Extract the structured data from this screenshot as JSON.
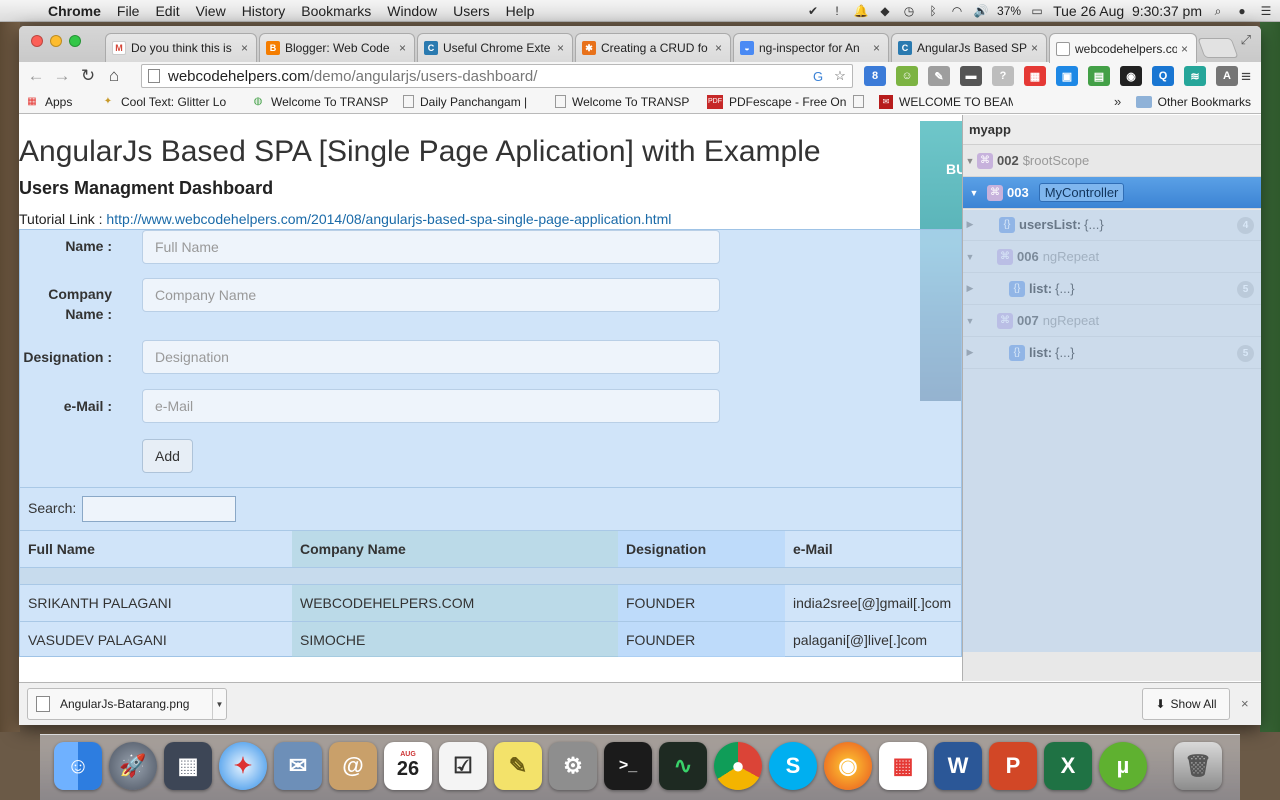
{
  "menubar": {
    "app": "Chrome",
    "items": [
      "File",
      "Edit",
      "View",
      "History",
      "Bookmarks",
      "Window",
      "Users",
      "Help"
    ],
    "battery": "37%",
    "datetime": "Tue 26 Aug  9:30:37 pm"
  },
  "tabs": [
    {
      "title": "Do you think this is",
      "favicon": "gmail-icon",
      "color": "#d44638"
    },
    {
      "title": "Blogger: Web Code",
      "favicon": "blogger-icon",
      "color": "#f57d00"
    },
    {
      "title": "Useful Chrome Exte",
      "favicon": "webcodehelpers-icon",
      "color": "#2a7ab0"
    },
    {
      "title": "Creating a CRUD fo",
      "favicon": "orange-icon",
      "color": "#e8711a"
    },
    {
      "title": "ng-inspector for An",
      "favicon": "chrome-store-icon",
      "color": "#4a8af4"
    },
    {
      "title": "AngularJs Based SP",
      "favicon": "webcodehelpers-icon",
      "color": "#2a7ab0"
    },
    {
      "title": "webcodehelpers.co",
      "favicon": "page-icon",
      "color": "#ffffff"
    }
  ],
  "address": {
    "host": "webcodehelpers.com",
    "path": "/demo/angularjs/users-dashboard/"
  },
  "bookmarks": [
    {
      "label": "Apps",
      "icon": "apps-grid-icon"
    },
    {
      "label": "Cool Text: Glitter Lo",
      "icon": "cooltext-icon"
    },
    {
      "label": "Welcome To TRANSP",
      "icon": "globe-icon"
    },
    {
      "label": "Daily Panchangam | ",
      "icon": "page-icon"
    },
    {
      "label": "Welcome To TRANSP",
      "icon": "page-icon"
    },
    {
      "label": "PDFescape - Free On",
      "icon": "pdf-icon"
    },
    {
      "label": "",
      "icon": "page-icon"
    },
    {
      "label": "WELCOME TO BEAM",
      "icon": "beam-icon"
    }
  ],
  "bookmarks_other": "Other Bookmarks",
  "page": {
    "title": "AngularJs Based SPA [Single Page Aplication] with Example",
    "subtitle": "Users Managment Dashboard",
    "tutorial_prefix": "Tutorial Link :",
    "tutorial_url": "http://www.webcodehelpers.com/2014/08/angularjs-based-spa-single-page-application.html",
    "banner_text": "BU"
  },
  "form": {
    "name_label": "Name :",
    "name_placeholder": "Full Name",
    "company_label_1": "Company",
    "company_label_2": "Name :",
    "company_placeholder": "Company Name",
    "designation_label": "Designation :",
    "designation_placeholder": "Designation",
    "email_label": "e-Mail :",
    "email_placeholder": "e-Mail",
    "add_label": "Add",
    "search_label": "Search:"
  },
  "table": {
    "headers": [
      "Full Name",
      "Company Name",
      "Designation",
      "e-Mail"
    ],
    "rows": [
      [
        "SRIKANTH PALAGANI",
        "WEBCODEHELPERS.COM",
        "FOUNDER",
        "india2sree[@]gmail[.]com"
      ],
      [
        "VASUDEV PALAGANI",
        "SIMOCHE",
        "FOUNDER",
        "palagani[@]live[.]com"
      ]
    ]
  },
  "panel": {
    "title": "myapp",
    "scopes": [
      {
        "num": "002",
        "name": "$rootScope"
      },
      {
        "num": "003",
        "name": "MyController"
      },
      {
        "key": "usersList:",
        "val": "{...}",
        "count": "4"
      },
      {
        "num": "006",
        "name": "ngRepeat"
      },
      {
        "key": "list:",
        "val": "{...}",
        "count": "5"
      },
      {
        "num": "007",
        "name": "ngRepeat"
      },
      {
        "key": "list:",
        "val": "{...}",
        "count": "5"
      }
    ]
  },
  "download": {
    "filename": "AngularJs-Batarang.png",
    "show_all": "Show All"
  },
  "dock": {
    "calendar_month": "AUG",
    "calendar_day": "26"
  }
}
